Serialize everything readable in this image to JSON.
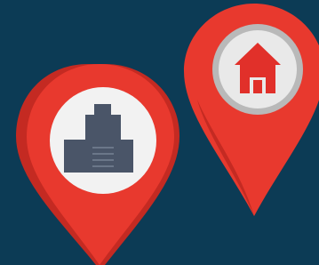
{
  "scene": {
    "background_color": "#0c3b55",
    "pins": [
      {
        "name": "office-location-pin",
        "icon": "office-building-icon",
        "pin_color": "#e8392e",
        "pin_shade_color": "#c42a22",
        "inner_circle_color": "#f2f2f2",
        "icon_color": "#4a5568"
      },
      {
        "name": "home-location-pin",
        "icon": "house-icon",
        "pin_color": "#e8392e",
        "pin_shade_color": "#c42a22",
        "inner_circle_color": "#e9e9e9",
        "ring_color": "#b9b9b9",
        "icon_color": "#e1302a"
      }
    ]
  }
}
